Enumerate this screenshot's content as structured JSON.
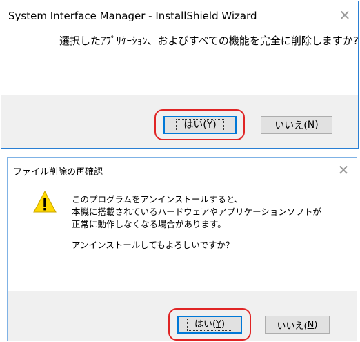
{
  "dialog1": {
    "title": "System Interface Manager - InstallShield Wizard",
    "message": "選択したｱﾌﾟﾘｹｰｼｮﾝ、およびすべての機能を完全に削除しますか?",
    "yes_label": "はい(",
    "yes_key": "Y",
    "yes_suffix": ")",
    "no_label": "いいえ(",
    "no_key": "N",
    "no_suffix": ")",
    "close_icon": "close-icon"
  },
  "dialog2": {
    "title": "ファイル削除の再確認",
    "message_lines": [
      "このプログラムをアンインストールすると、",
      "本機に搭載されているハードウェアやアプリケーションソフトが",
      "正常に動作しなくなる場合があります。"
    ],
    "question": "アンインストールしてもよろしいですか？",
    "yes_label": "はい(",
    "yes_key": "Y",
    "yes_suffix": ")",
    "no_label": "いいえ(",
    "no_key": "N",
    "no_suffix": ")",
    "icon": "warning-icon",
    "close_icon": "close-icon"
  },
  "colors": {
    "highlight": "#e02525",
    "default_button_border": "#0078d7",
    "footer_bg": "#f0f0f0",
    "warning_fill": "#ffd800"
  }
}
